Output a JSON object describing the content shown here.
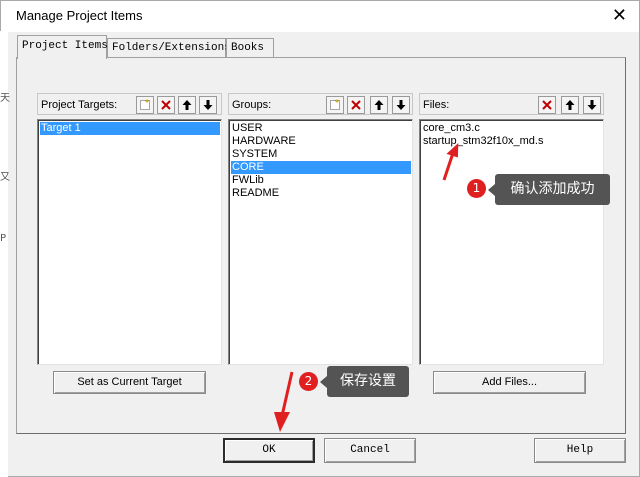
{
  "window": {
    "title": "Manage Project Items",
    "close_glyph": "✕"
  },
  "left_edge_glyphs": [
    "天",
    "又",
    "P"
  ],
  "tabs": [
    {
      "label": "Project Items",
      "active": true
    },
    {
      "label": "Folders/Extensions",
      "active": false
    },
    {
      "label": "Books",
      "active": false
    }
  ],
  "targets_pane": {
    "label": "Project Targets:",
    "items": [
      {
        "text": "Target 1",
        "selected": true
      }
    ],
    "toolbar_icons": [
      "new-icon",
      "delete-icon",
      "move-up-icon",
      "move-down-icon"
    ]
  },
  "groups_pane": {
    "label": "Groups:",
    "items": [
      {
        "text": "USER",
        "selected": false
      },
      {
        "text": "HARDWARE",
        "selected": false
      },
      {
        "text": "SYSTEM",
        "selected": false
      },
      {
        "text": "CORE",
        "selected": true
      },
      {
        "text": "FWLib",
        "selected": false
      },
      {
        "text": "README",
        "selected": false
      }
    ],
    "toolbar_icons": [
      "new-icon",
      "delete-icon",
      "move-up-icon",
      "move-down-icon"
    ]
  },
  "files_pane": {
    "label": "Files:",
    "items": [
      {
        "text": "core_cm3.c",
        "selected": false
      },
      {
        "text": "startup_stm32f10x_md.s",
        "selected": false
      }
    ],
    "toolbar_icons": [
      "delete-icon",
      "move-up-icon",
      "move-down-icon"
    ]
  },
  "buttons": {
    "set_current_target": "Set as Current Target",
    "add_files": "Add Files...",
    "ok": "OK",
    "cancel": "Cancel",
    "help": "Help"
  },
  "annotations": [
    {
      "number": "1",
      "text": "确认添加成功"
    },
    {
      "number": "2",
      "text": "保存设置"
    }
  ],
  "colors": {
    "selection": "#3399ff",
    "annotation_red": "#e02020",
    "annotation_box": "#545454"
  }
}
